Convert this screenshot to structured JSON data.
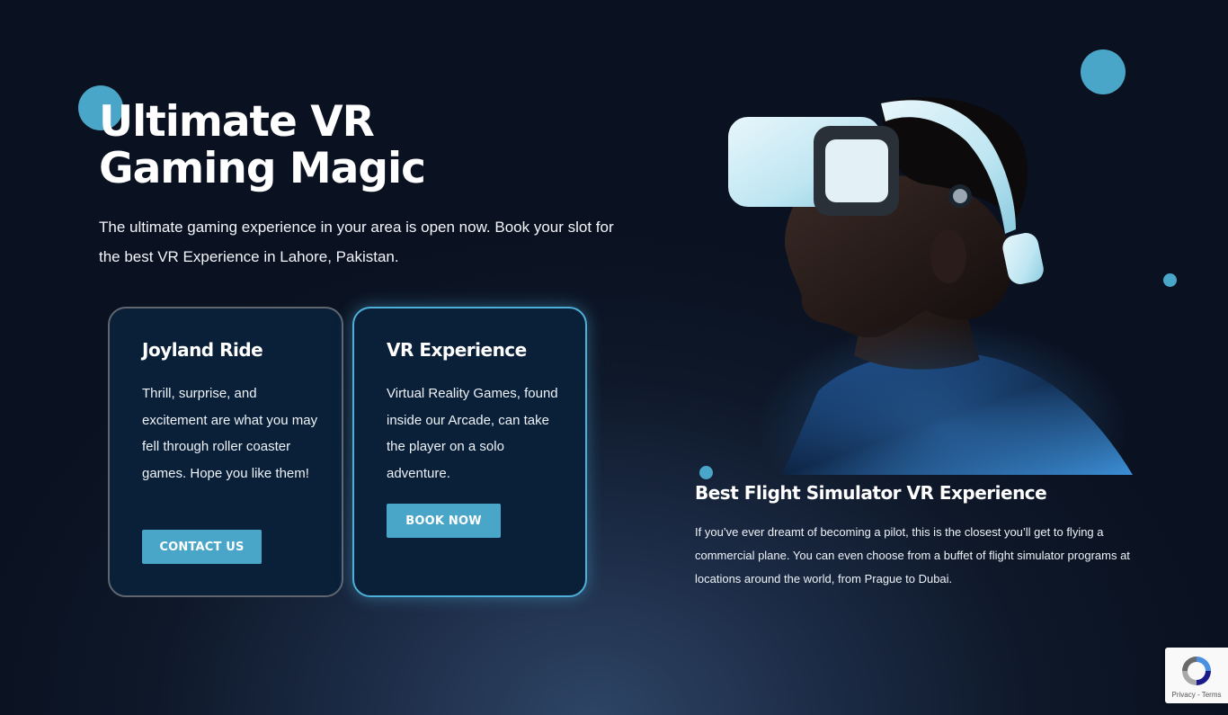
{
  "hero": {
    "title_line1": "Ultimate VR",
    "title_line2": "Gaming Magic",
    "subtitle": "The ultimate gaming experience in your area is open now. Book your slot for the best VR Experience in Lahore, Pakistan."
  },
  "cards": [
    {
      "title": "Joyland Ride",
      "text": "Thrill, surprise, and excitement are what you may fell through roller coaster games. Hope you like them!",
      "button_label": "CONTACT US"
    },
    {
      "title": "VR Experience",
      "text": "Virtual Reality Games, found inside our Arcade, can take the player on a solo adventure.",
      "button_label": "BOOK NOW"
    }
  ],
  "feature": {
    "title": "Best Flight Simulator VR Experience",
    "text": "If you’ve ever dreamt of becoming a pilot, this is the closest you’ll get to flying a commercial plane. You can even choose from a buffet of flight simulator programs at locations around the world, from Prague to Dubai."
  },
  "recaptcha": {
    "privacy_label": "Privacy",
    "separator": " - ",
    "terms_label": "Terms"
  },
  "colors": {
    "accent": "#4aa6c9",
    "background_dark": "#0a1120",
    "card_background": "#0a1f38",
    "card_border_muted": "#5f6670",
    "card_border_active": "#4eb0d8"
  },
  "icons": {
    "hero_image": "vr-headset-person-image",
    "recaptcha": "recaptcha-logo-icon"
  }
}
